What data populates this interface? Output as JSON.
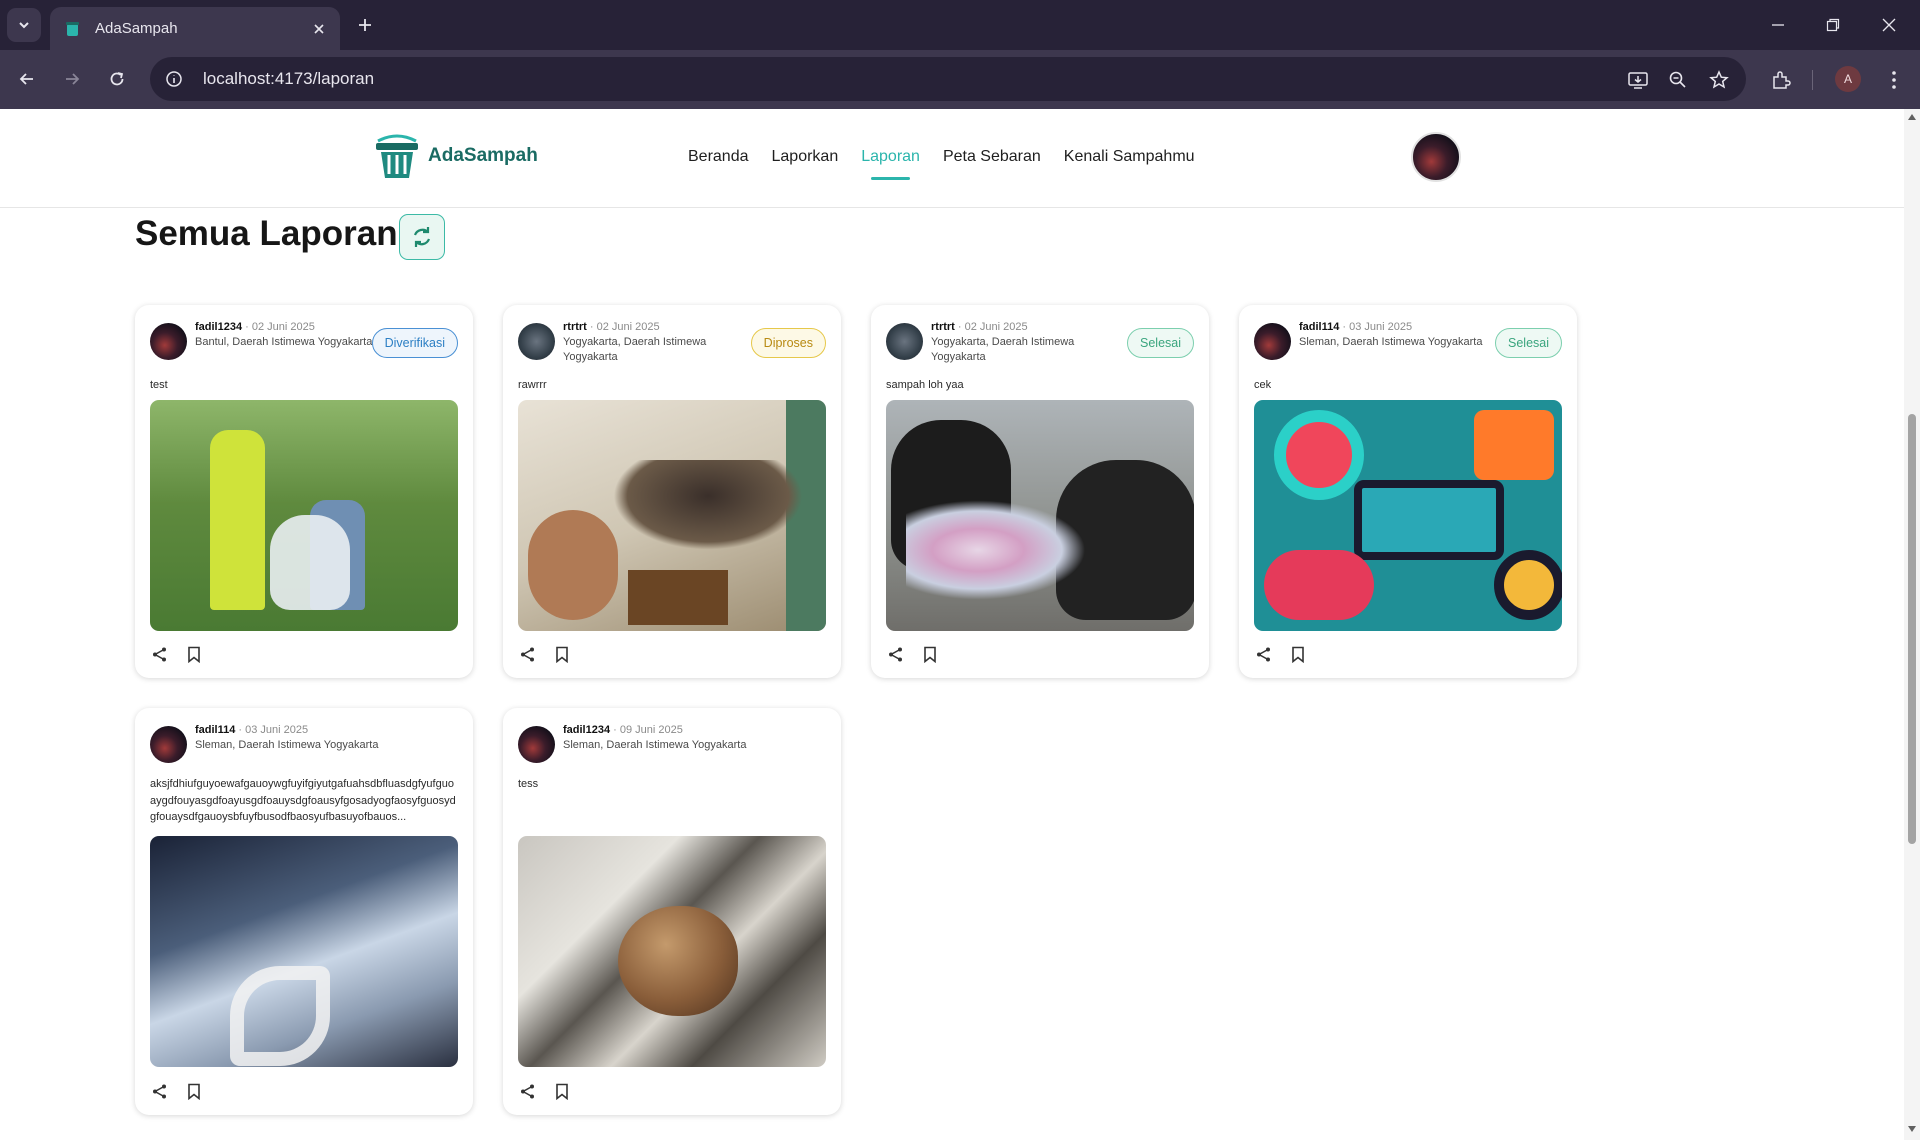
{
  "browser": {
    "tab_title": "AdaSampah",
    "url": "localhost:4173/laporan",
    "profile_initial": "A"
  },
  "site": {
    "logo_text": "AdaSampah",
    "nav": [
      "Beranda",
      "Laporkan",
      "Laporan",
      "Peta Sebaran",
      "Kenali Sampahmu"
    ],
    "active_nav": "Laporan"
  },
  "page": {
    "title": "Semua Laporan"
  },
  "reports": [
    {
      "user": "fadil1234",
      "date": "02 Juni 2025",
      "location": "Bantul, Daerah Istimewa Yogyakarta",
      "status": "Diverifikasi",
      "description": "test",
      "photo": "volunteers-cleaning-park"
    },
    {
      "user": "rtrtrt",
      "date": "02 Juni 2025",
      "location": "Yogyakarta, Daerah Istimewa Yogyakarta",
      "status": "Diproses",
      "description": "rawrrr",
      "photo": "group-selfie"
    },
    {
      "user": "rtrtrt",
      "date": "02 Juni 2025",
      "location": "Yogyakarta, Daerah Istimewa Yogyakarta",
      "status": "Selesai",
      "description": "sampah loh yaa",
      "photo": "trash-bags-pile"
    },
    {
      "user": "fadil114",
      "date": "03 Juni 2025",
      "location": "Sleman, Daerah Istimewa Yogyakarta",
      "status": "Selesai",
      "description": "cek",
      "photo": "colorful-pattern"
    },
    {
      "user": "fadil114",
      "date": "03 Juni 2025",
      "location": "Sleman, Daerah Istimewa Yogyakarta",
      "status": "",
      "description": "aksjfdhiufguyoewafgauoywgfuyifgiyutgafuahsdbfluasdgfyufguoaygdfouyasgdfoayusgdfoauysdgfoausyfgosadyogfaosyfguosydgfouaysdfgauoysbfuyfbusodfbaosyufbasuyofbauos...",
      "photo": "fantasy-artwork"
    },
    {
      "user": "fadil1234",
      "date": "09 Juni 2025",
      "location": "Sleman, Daerah Istimewa Yogyakarta",
      "status": "",
      "description": "tess",
      "photo": "walnut"
    }
  ],
  "colors": {
    "brand": "#1a6b63",
    "accent": "#2bb5ac",
    "status_verified": "#2c7fc4",
    "status_process": "#b88a12",
    "status_done": "#3aa57e"
  },
  "icons": {
    "share": "share-icon",
    "bookmark": "bookmark-icon",
    "refresh": "refresh-icon"
  }
}
